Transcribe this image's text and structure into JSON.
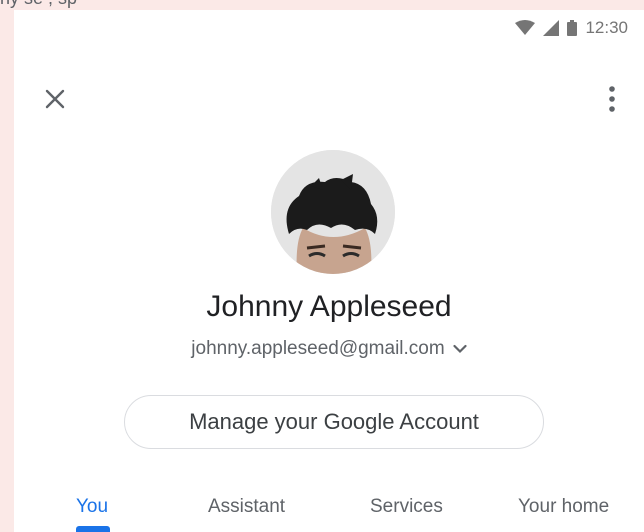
{
  "top_strip": {
    "text": "ny se  , sp"
  },
  "status_bar": {
    "time": "12:30",
    "icons": [
      "wifi-icon",
      "cell-signal-icon",
      "battery-icon"
    ]
  },
  "header": {
    "close_icon": "close-icon",
    "more_icon": "more-vert-icon"
  },
  "profile": {
    "name": "Johnny Appleseed",
    "email": "johnny.appleseed@gmail.com",
    "email_dropdown_icon": "chevron-down-icon"
  },
  "manage_button": {
    "label": "Manage your Google Account"
  },
  "tabs": [
    {
      "label": "You"
    },
    {
      "label": "Assistant"
    },
    {
      "label": "Services"
    },
    {
      "label": "Your home"
    }
  ],
  "colors": {
    "accent": "#1a73e8",
    "text_primary": "#202124",
    "text_secondary": "#5f6368",
    "border": "#dadce0",
    "background_outer": "#fbe9e7"
  }
}
